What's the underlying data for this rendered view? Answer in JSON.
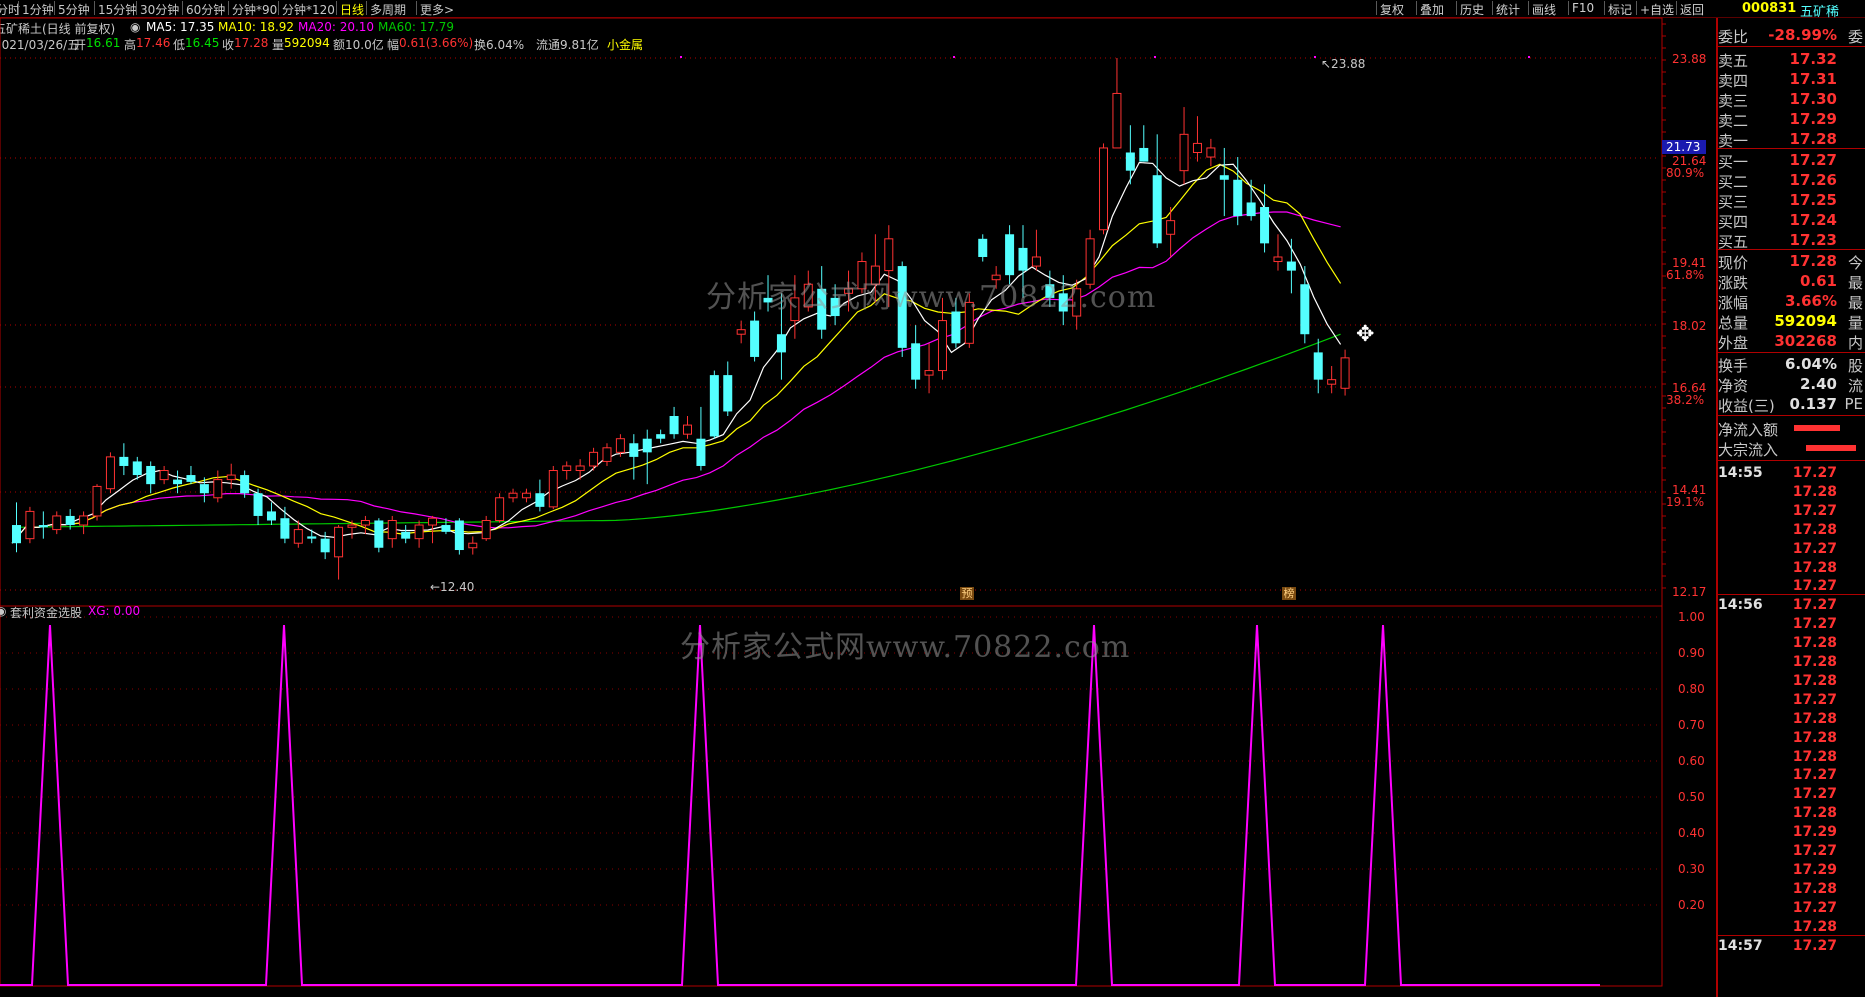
{
  "toolbar": {
    "tabs": [
      "分时",
      "1分钟",
      "5分钟",
      "15分钟",
      "30分钟",
      "60分钟",
      "分钟*90",
      "分钟*120",
      "日线",
      "多周期",
      "更多>"
    ],
    "active_tab": "日线",
    "right_tools": [
      "复权",
      "叠加",
      "历史",
      "统计",
      "画线",
      "F10",
      "标记",
      "+自选",
      "返回"
    ],
    "stock_code": "000831",
    "stock_name": "五矿稀"
  },
  "title_line": {
    "name": "五矿稀土(日线 前复权)",
    "ma5": "MA5: 17.35",
    "ma10": "MA10: 18.92",
    "ma20": "MA20: 20.10",
    "ma60": "MA60: 17.79"
  },
  "info_line": {
    "date": "2021/03/26/五",
    "open_label": "开",
    "open": "16.61",
    "high_label": "高",
    "high": "17.46",
    "low_label": "低",
    "low": "16.45",
    "close_label": "收",
    "close": "17.28",
    "vol_label": "量",
    "vol": "592094",
    "amount": "额10.0亿",
    "amp_label": "幅",
    "amp": "0.61(3.66%)",
    "turnover": "换6.04%",
    "float": "流通9.81亿",
    "sector": "小金属"
  },
  "price_axis": {
    "labels": [
      "23.88",
      "21.64",
      "80.9%",
      "19.41",
      "61.8%",
      "18.02",
      "16.64",
      "38.2%",
      "14.41",
      "19.1%",
      "12.17"
    ],
    "marker": "21.73",
    "high_note": "23.88",
    "low_note": "12.40"
  },
  "indicator": {
    "name": "套利资金选股",
    "xg": "XG: 0.00",
    "axis": [
      "1.00",
      "0.90",
      "0.80",
      "0.70",
      "0.60",
      "0.50",
      "0.40",
      "0.30",
      "0.20"
    ]
  },
  "markers": {
    "m1": "预",
    "m2": "榜"
  },
  "watermark": "分析家公式网www.70822.com",
  "right_panel": {
    "weibi_label": "委比",
    "weibi": "-28.99%",
    "weibi_suffix": "委",
    "asks": [
      {
        "label": "卖五",
        "price": "17.32"
      },
      {
        "label": "卖四",
        "price": "17.31"
      },
      {
        "label": "卖三",
        "price": "17.30"
      },
      {
        "label": "卖二",
        "price": "17.29"
      },
      {
        "label": "卖一",
        "price": "17.28"
      }
    ],
    "bids": [
      {
        "label": "买一",
        "price": "17.27"
      },
      {
        "label": "买二",
        "price": "17.26"
      },
      {
        "label": "买三",
        "price": "17.25"
      },
      {
        "label": "买四",
        "price": "17.24"
      },
      {
        "label": "买五",
        "price": "17.23"
      }
    ],
    "quote": [
      {
        "label": "现价",
        "value": "17.28",
        "suffix": "今",
        "color": "#ff3232"
      },
      {
        "label": "涨跌",
        "value": "0.61",
        "suffix": "最",
        "color": "#ff3232"
      },
      {
        "label": "涨幅",
        "value": "3.66%",
        "suffix": "最",
        "color": "#ff3232"
      },
      {
        "label": "总量",
        "value": "592094",
        "suffix": "量",
        "color": "#ffff00"
      },
      {
        "label": "外盘",
        "value": "302268",
        "suffix": "内",
        "color": "#ff3232"
      }
    ],
    "stats": [
      {
        "label": "换手",
        "value": "6.04%",
        "suffix": "股",
        "color": "#e0e0e0"
      },
      {
        "label": "净资",
        "value": "2.40",
        "suffix": "流",
        "color": "#e0e0e0"
      },
      {
        "label": "收益(三)",
        "value": "0.137",
        "suffix": "PE",
        "color": "#e0e0e0"
      }
    ],
    "flow": [
      {
        "label": "净流入额"
      },
      {
        "label": "大宗流入"
      }
    ],
    "ticks": [
      {
        "time": "14:55",
        "value": "17.27"
      },
      {
        "time": "",
        "value": "17.28"
      },
      {
        "time": "",
        "value": "17.27"
      },
      {
        "time": "",
        "value": "17.28"
      },
      {
        "time": "",
        "value": "17.27"
      },
      {
        "time": "",
        "value": "17.28"
      },
      {
        "time": "",
        "value": "17.27"
      },
      {
        "time": "14:56",
        "value": "17.27"
      },
      {
        "time": "",
        "value": "17.27"
      },
      {
        "time": "",
        "value": "17.28"
      },
      {
        "time": "",
        "value": "17.28"
      },
      {
        "time": "",
        "value": "17.28"
      },
      {
        "time": "",
        "value": "17.27"
      },
      {
        "time": "",
        "value": "17.28"
      },
      {
        "time": "",
        "value": "17.28"
      },
      {
        "time": "",
        "value": "17.28"
      },
      {
        "time": "",
        "value": "17.27"
      },
      {
        "time": "",
        "value": "17.27"
      },
      {
        "time": "",
        "value": "17.28"
      },
      {
        "time": "",
        "value": "17.29"
      },
      {
        "time": "",
        "value": "17.27"
      },
      {
        "time": "",
        "value": "17.29"
      },
      {
        "time": "",
        "value": "17.28"
      },
      {
        "time": "",
        "value": "17.27"
      },
      {
        "time": "",
        "value": "17.28"
      },
      {
        "time": "14:57",
        "value": "17.27"
      }
    ]
  },
  "colors": {
    "up": "#ff3232",
    "down": "#54ffff",
    "ma5": "#ffffff",
    "ma10": "#ffff00",
    "ma20": "#ff00ff",
    "ma60": "#00c800",
    "indicator": "#ff00ff"
  },
  "chart_data": {
    "type": "candlestick",
    "price_range": [
      12.17,
      23.88
    ],
    "ohlc_note": "per-bar OHLC estimated from image",
    "indicator_signal_bars": [
      3,
      17,
      42,
      66,
      76,
      84
    ]
  }
}
